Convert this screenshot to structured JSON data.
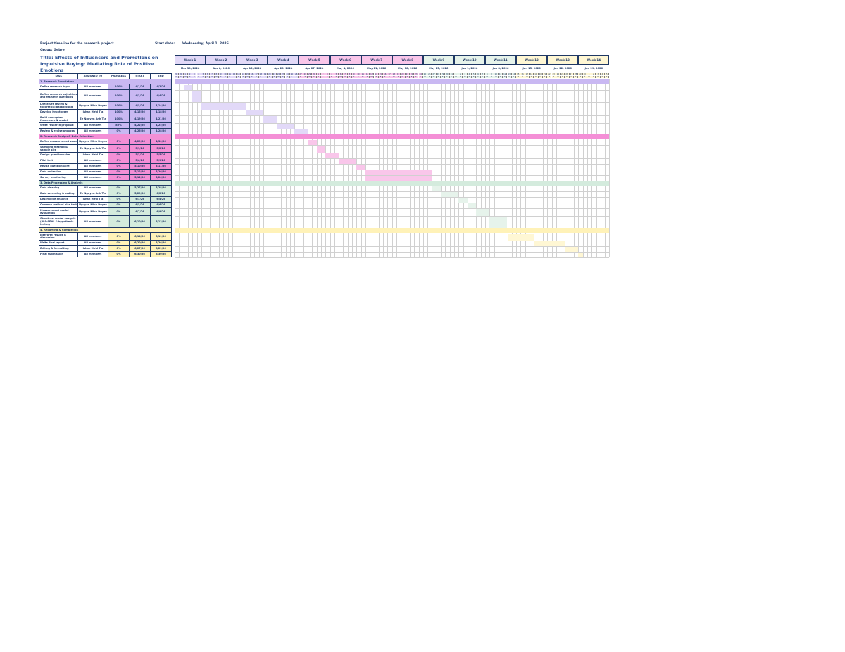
{
  "header": {
    "project_label": "Project timeline for the research project",
    "group_label": "Group: Gebre",
    "start_date_label": "Start date:",
    "start_date_value": "Wednesday, April 1, 2026",
    "title": "Title: Effects of Influencers and Promotions on Impulsive Buying: Mediating Role of Positive Emotions"
  },
  "columns": {
    "task": "TASK",
    "assigned": "ASSIGNED TO",
    "progress": "PROGRESS",
    "start": "START",
    "end": "END"
  },
  "colors": {
    "phase1": "#c9b8f2",
    "phase1_bar": "#e2d9f8",
    "phase2": "#f48fd6",
    "phase2_bar": "#f9c6ea",
    "phase3": "#d4ebdd",
    "phase3_bar": "#e6f3eb",
    "phase4": "#fff2b8",
    "phase4_bar": "#fff7d4"
  },
  "weeks": [
    {
      "label": "Week 1",
      "date": "Mar 30, 2026",
      "color": "#e2d9f8"
    },
    {
      "label": "Week 2",
      "date": "Apr 6, 2026",
      "color": "#e2d9f8"
    },
    {
      "label": "Week 3",
      "date": "Apr 13, 2026",
      "color": "#e2d9f8"
    },
    {
      "label": "Week 4",
      "date": "Apr 20, 2026",
      "color": "#e2d9f8"
    },
    {
      "label": "Week 5",
      "date": "Apr 27, 2026",
      "color": "#f9c6ea"
    },
    {
      "label": "Week 6",
      "date": "May 4, 2026",
      "color": "#f9c6ea"
    },
    {
      "label": "Week 7",
      "date": "May 11, 2026",
      "color": "#f9c6ea"
    },
    {
      "label": "Week 8",
      "date": "May 18, 2026",
      "color": "#f9c6ea"
    },
    {
      "label": "Week 9",
      "date": "May 25, 2026",
      "color": "#e6f3eb"
    },
    {
      "label": "Week 10",
      "date": "Jun 1, 2026",
      "color": "#e6f3eb"
    },
    {
      "label": "Week 11",
      "date": "Jun 8, 2026",
      "color": "#e6f3eb"
    },
    {
      "label": "Week 12",
      "date": "Jun 15, 2026",
      "color": "#fff7d4"
    },
    {
      "label": "Week 13",
      "date": "Jun 22, 2026",
      "color": "#fff7d4"
    },
    {
      "label": "Week 14",
      "date": "Jun 29, 2026",
      "color": "#fff7d4"
    }
  ],
  "phases": [
    {
      "name": "1. Research Foundation",
      "tasks": [
        {
          "task": "Define research topic",
          "assigned": "All members",
          "progress": "100%",
          "start": "4/1/26",
          "end": "4/2/26",
          "bar_start": 2,
          "bar_days": 2
        },
        {
          "task": "Define research objectives and research questions",
          "assigned": "All members",
          "progress": "100%",
          "start": "4/3/26",
          "end": "4/4/26",
          "bar_start": 4,
          "bar_days": 2
        },
        {
          "task": "Literature review & theoretical background",
          "assigned": "Nguyen Minh Duyen",
          "progress": "100%",
          "start": "4/5/26",
          "end": "4/14/26",
          "bar_start": 6,
          "bar_days": 10
        },
        {
          "task": "Develop hypotheses",
          "assigned": "Ishan Hirbi Tia",
          "progress": "100%",
          "start": "4/15/26",
          "end": "4/18/26",
          "bar_start": 16,
          "bar_days": 4
        },
        {
          "task": "Build conceptual framework & model",
          "assigned": "Ee Nguyen Anh Tia",
          "progress": "100%",
          "start": "4/19/26",
          "end": "4/21/26",
          "bar_start": 20,
          "bar_days": 3
        },
        {
          "task": "Write research proposal",
          "assigned": "All members",
          "progress": "80%",
          "start": "4/22/26",
          "end": "4/25/26",
          "bar_start": 23,
          "bar_days": 4
        },
        {
          "task": "Review & revise proposal",
          "assigned": "All members",
          "progress": "0%",
          "start": "4/26/26",
          "end": "4/28/26",
          "bar_start": 27,
          "bar_days": 3
        }
      ]
    },
    {
      "name": "2. Research Design & Data Collection",
      "tasks": [
        {
          "task": "Define measurement scale",
          "assigned": "Nguyen Minh Duyen",
          "progress": "0%",
          "start": "4/29/26",
          "end": "4/30/26",
          "bar_start": 30,
          "bar_days": 2
        },
        {
          "task": "Sampling method & sample size",
          "assigned": "Ee Nguyen Anh Tia",
          "progress": "0%",
          "start": "5/1/26",
          "end": "5/2/26",
          "bar_start": 32,
          "bar_days": 2
        },
        {
          "task": "Design questionnaire",
          "assigned": "Ishan Hirbi Tia",
          "progress": "0%",
          "start": "5/3/26",
          "end": "5/5/26",
          "bar_start": 34,
          "bar_days": 3
        },
        {
          "task": "Pilot test",
          "assigned": "All members",
          "progress": "0%",
          "start": "5/6/26",
          "end": "5/9/26",
          "bar_start": 37,
          "bar_days": 4
        },
        {
          "task": "Revise questionnaire",
          "assigned": "All members",
          "progress": "0%",
          "start": "5/10/26",
          "end": "5/11/26",
          "bar_start": 41,
          "bar_days": 2
        },
        {
          "task": "Data collection",
          "assigned": "All members",
          "progress": "0%",
          "start": "5/12/26",
          "end": "5/26/26",
          "bar_start": 43,
          "bar_days": 15
        },
        {
          "task": "Survey monitoring",
          "assigned": "All members",
          "progress": "0%",
          "start": "5/12/26",
          "end": "5/26/26",
          "bar_start": 43,
          "bar_days": 15
        }
      ]
    },
    {
      "name": "3. Data Processing & Analysis",
      "tasks": [
        {
          "task": "Data cleaning",
          "assigned": "All members",
          "progress": "0%",
          "start": "5/27/26",
          "end": "5/28/26",
          "bar_start": 58,
          "bar_days": 2
        },
        {
          "task": "Data screening & coding",
          "assigned": "Ee Nguyen Anh Tia",
          "progress": "0%",
          "start": "5/29/26",
          "end": "6/2/26",
          "bar_start": 60,
          "bar_days": 4
        },
        {
          "task": "Descriptive analysis",
          "assigned": "Ishan Hirbi Tia",
          "progress": "0%",
          "start": "6/3/26",
          "end": "6/4/26",
          "bar_start": 64,
          "bar_days": 2
        },
        {
          "task": "Common method bias test",
          "assigned": "Nguyen Minh Duyen",
          "progress": "0%",
          "start": "6/5/26",
          "end": "6/6/26",
          "bar_start": 66,
          "bar_days": 2
        },
        {
          "task": "Measurement model evaluation",
          "assigned": "Nguyen Minh Duyen",
          "progress": "0%",
          "start": "6/7/26",
          "end": "6/9/26",
          "bar_start": 68,
          "bar_days": 3
        },
        {
          "task": "Structural model analysis (PLS-SEM) & hypothesis testing",
          "assigned": "All members",
          "progress": "0%",
          "start": "6/10/26",
          "end": "6/13/26",
          "bar_start": 71,
          "bar_days": 4
        }
      ]
    },
    {
      "name": "4. Reporting & Completion",
      "tasks": [
        {
          "task": "Interpret results & discussion",
          "assigned": "All members",
          "progress": "0%",
          "start": "6/14/26",
          "end": "6/19/26",
          "bar_start": 75,
          "bar_days": 6
        },
        {
          "task": "Write final report",
          "assigned": "All members",
          "progress": "0%",
          "start": "6/20/26",
          "end": "6/26/26",
          "bar_start": 81,
          "bar_days": 7
        },
        {
          "task": "Editing & formatting",
          "assigned": "Ishan Hirbi Tia",
          "progress": "0%",
          "start": "6/27/26",
          "end": "6/29/26",
          "bar_start": 88,
          "bar_days": 3
        },
        {
          "task": "Final submission",
          "assigned": "All members",
          "progress": "0%",
          "start": "6/30/26",
          "end": "6/30/26",
          "bar_start": 91,
          "bar_days": 1
        }
      ]
    }
  ],
  "day_numbers": [
    30,
    31,
    1,
    2,
    3,
    4,
    5,
    6,
    7,
    8,
    9,
    10,
    11,
    12,
    13,
    14,
    15,
    16,
    17,
    18,
    19,
    20,
    21,
    22,
    23,
    24,
    25,
    26,
    27,
    28,
    29,
    30,
    1,
    2,
    3,
    4,
    5,
    6,
    7,
    8,
    9,
    10,
    11,
    12,
    13,
    14,
    15,
    16,
    17,
    18,
    19,
    20,
    21,
    22,
    23,
    24,
    25,
    26,
    27,
    28,
    29,
    30,
    31,
    1,
    2,
    3,
    4,
    5,
    6,
    7,
    8,
    9,
    10,
    11,
    12,
    13,
    14,
    15,
    16,
    17,
    18,
    19,
    20,
    21,
    22,
    23,
    24,
    25,
    26,
    27,
    28,
    29,
    30,
    1,
    2,
    3,
    4,
    5
  ],
  "day_letters": [
    "M",
    "T",
    "W",
    "T",
    "F",
    "S",
    "S"
  ]
}
